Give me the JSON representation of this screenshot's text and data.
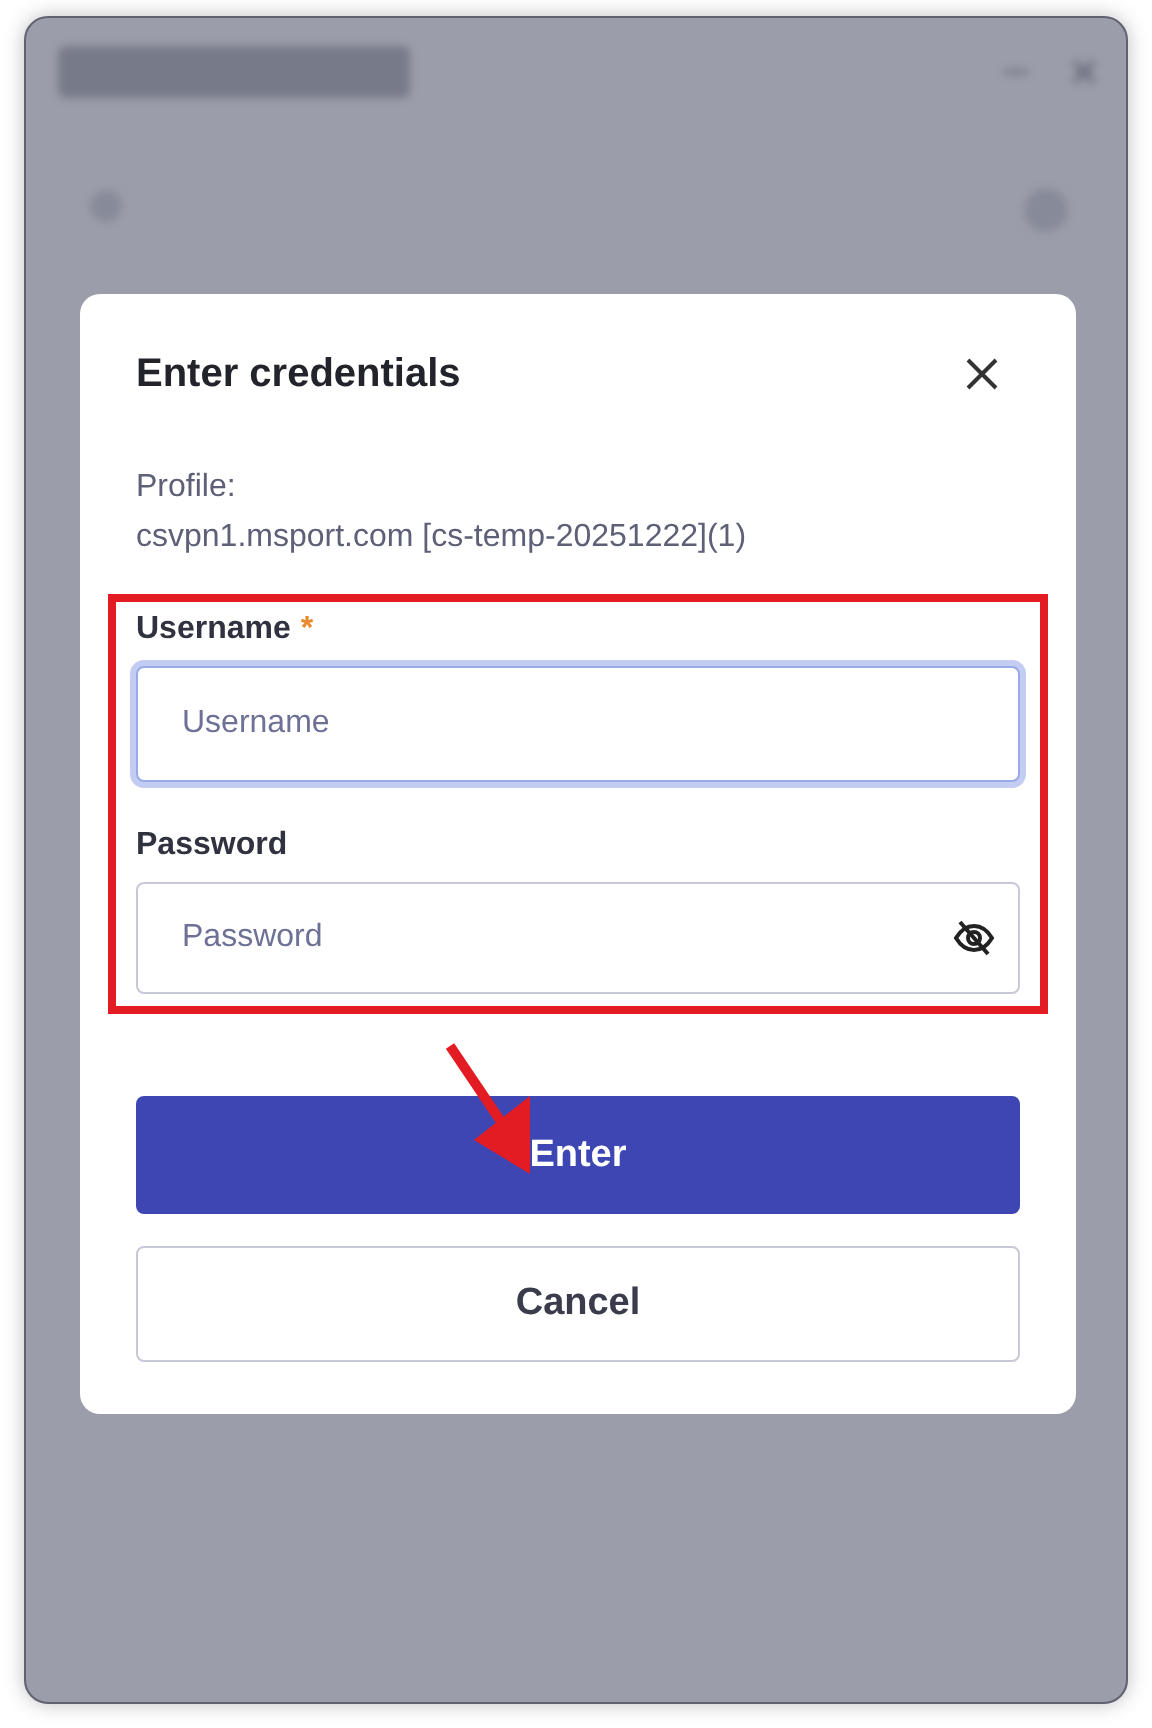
{
  "dialog": {
    "title": "Enter credentials",
    "profile_label": "Profile:",
    "profile_value": "csvpn1.msport.com [cs-temp-20251222](1)",
    "fields": [
      {
        "kind": "text",
        "label": "Username",
        "required_mark": "*",
        "placeholder": "Username",
        "focused": true
      },
      {
        "kind": "password",
        "label": "Password",
        "placeholder": "Password",
        "focused": false
      }
    ],
    "buttons": [
      {
        "kind": "primary",
        "label": "Enter"
      },
      {
        "kind": "secondary",
        "label": "Cancel"
      }
    ]
  },
  "annotation": {
    "kind": "box-and-arrow"
  }
}
